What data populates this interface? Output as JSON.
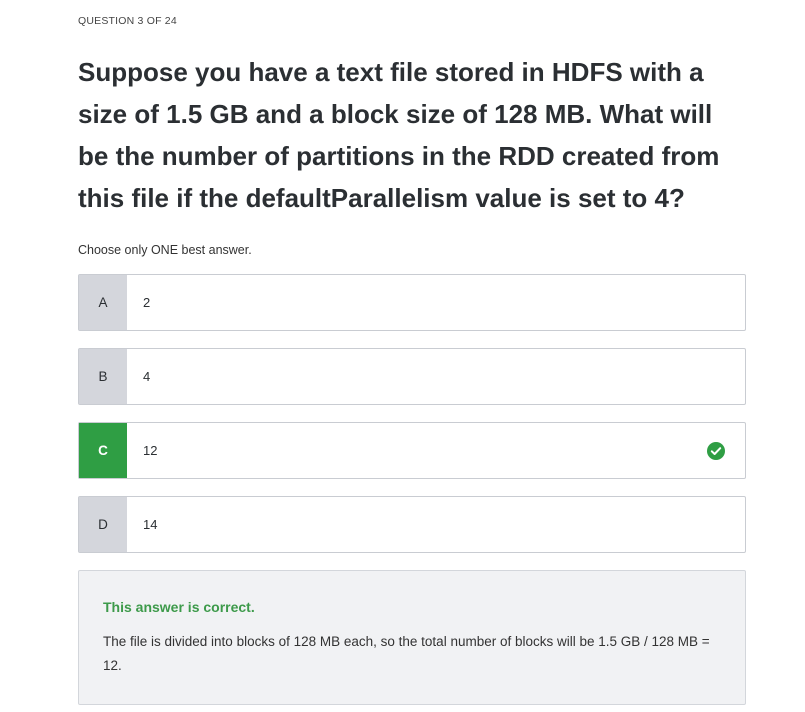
{
  "question": {
    "counter": "QUESTION 3 OF 24",
    "text": "Suppose you have a text file stored in HDFS with a size of 1.5 GB and a block size of 128 MB. What will be the number of partitions in the RDD created from this file if the defaultParallelism value is set to 4?",
    "instruction": "Choose only ONE best answer."
  },
  "options": [
    {
      "letter": "A",
      "text": "2"
    },
    {
      "letter": "B",
      "text": "4"
    },
    {
      "letter": "C",
      "text": "12"
    },
    {
      "letter": "D",
      "text": "14"
    }
  ],
  "selected": "C",
  "feedback": {
    "title": "This answer is correct.",
    "explanation": "The file is divided into blocks of 128 MB each, so the total number of blocks will be 1.5 GB / 128 MB = 12."
  },
  "colors": {
    "correct": "#2f9e44",
    "correct_text": "#3d9a4a",
    "letter_bg": "#d4d6dc"
  },
  "icons": {
    "correct_mark": "check-circle-icon"
  }
}
